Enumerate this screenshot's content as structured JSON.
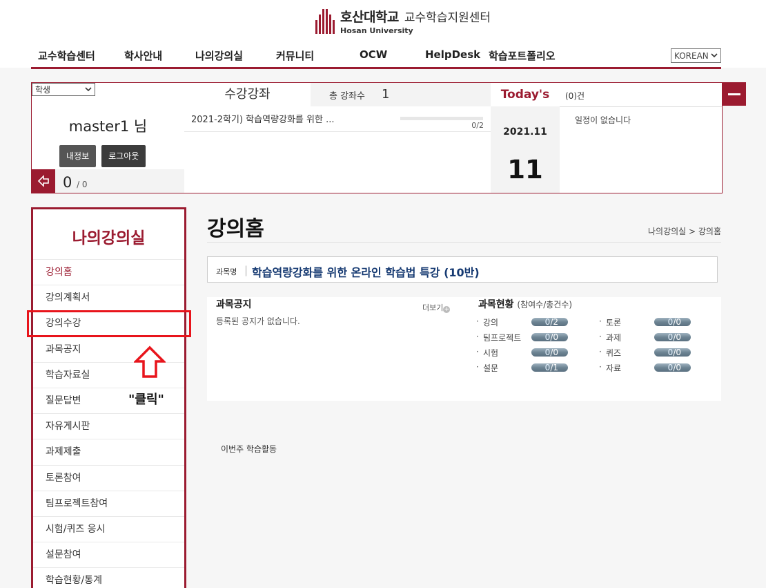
{
  "header": {
    "logo_ko": "호산대학교",
    "logo_center": "교수학습지원센터",
    "logo_en": "Hosan University"
  },
  "gnb": [
    {
      "label": "교수학습센터"
    },
    {
      "label": "학사안내"
    },
    {
      "label": "나의강의실"
    },
    {
      "label": "커뮤니티"
    },
    {
      "label": "OCW"
    },
    {
      "label": "HelpDesk"
    },
    {
      "label": "학습포트폴리오"
    }
  ],
  "language": {
    "selected": "KOREAN"
  },
  "user": {
    "role": "학생",
    "name": "master1",
    "suffix": "님",
    "myinfo_btn": "내정보",
    "logout_btn": "로그아웃",
    "points": "0",
    "points_total": "/ 0"
  },
  "courses": {
    "tab": "수강강좌",
    "total_label": "총 강좌수",
    "total_value": "1",
    "items": [
      {
        "title": "2021-2학기) 학습역량강화를 위한 ...",
        "progress": "0/2"
      }
    ]
  },
  "today": {
    "label": "Today's",
    "year_month": "2021.11",
    "day": "11"
  },
  "schedule": {
    "count": "(0)건",
    "empty": "일정이 없습니다"
  },
  "lnb": {
    "title": "나의강의실",
    "items": [
      {
        "label": "강의홈"
      },
      {
        "label": "강의계획서"
      },
      {
        "label": "강의수강"
      },
      {
        "label": "과목공지"
      },
      {
        "label": "학습자료실"
      },
      {
        "label": "질문답변"
      },
      {
        "label": "자유게시판"
      },
      {
        "label": "과제제출"
      },
      {
        "label": "토론참여"
      },
      {
        "label": "팀프로젝트참여"
      },
      {
        "label": "시험/퀴즈 응시"
      },
      {
        "label": "설문참여"
      },
      {
        "label": "학습현황/통계"
      }
    ]
  },
  "annotation": {
    "click_text": "\"클릭\"",
    "highlight_color": "#e8141b"
  },
  "main": {
    "title": "강의홈",
    "breadcrumb": "나의강의실 > 강의홈",
    "subject_label": "과목명",
    "subject_sep": "|",
    "subject_name": "학습역량강화를 위한 온라인 학습법 특강 (10반)",
    "notice_title": "과목공지",
    "more_label": "더보기",
    "notice_empty": "등록된 공지가 없습니다.",
    "status_title": "과목현황",
    "status_sub": "(참여수/총건수)",
    "weekly_label": "이번주 학습활동"
  },
  "stats": [
    {
      "label": "강의",
      "done": "0",
      "total": "/2"
    },
    {
      "label": "토론",
      "done": "0",
      "total": "/0"
    },
    {
      "label": "팀프로젝트",
      "done": "0",
      "total": "/0"
    },
    {
      "label": "과제",
      "done": "0",
      "total": "/0"
    },
    {
      "label": "시험",
      "done": "0",
      "total": "/0"
    },
    {
      "label": "퀴즈",
      "done": "0",
      "total": "/0"
    },
    {
      "label": "설문",
      "done": "0",
      "total": "/1"
    },
    {
      "label": "자료",
      "done": "0",
      "total": "/0"
    }
  ],
  "colors": {
    "brand": "#9b1b30",
    "subject": "#163a72",
    "pill": "#6d8493"
  }
}
